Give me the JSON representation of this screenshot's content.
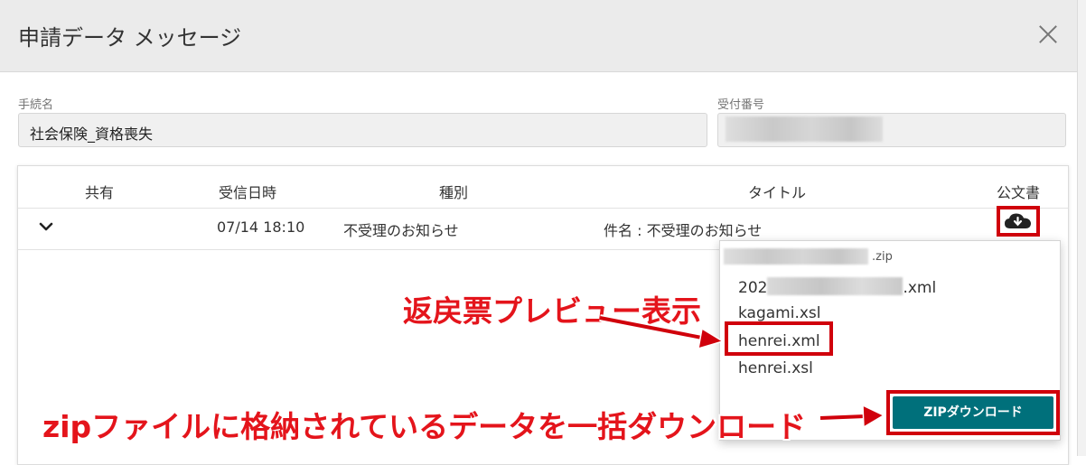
{
  "dialog": {
    "title": "申請データ メッセージ"
  },
  "fields": {
    "procedure_label": "手続名",
    "procedure_value": "社会保険_資格喪失",
    "receipt_label": "受付番号"
  },
  "table": {
    "headers": {
      "share": "共有",
      "received": "受信日時",
      "type": "種別",
      "title": "タイトル",
      "official": "公文書"
    },
    "row": {
      "received": "07/14 18:10",
      "type": "不受理のお知らせ",
      "title": "件名 : 不受理のお知らせ"
    }
  },
  "dropdown": {
    "zip_suffix": ".zip",
    "files": [
      {
        "prefix": "202",
        "suffix": ".xml"
      },
      {
        "name": "kagami.xsl"
      },
      {
        "name": "henrei.xml"
      },
      {
        "name": "henrei.xsl"
      }
    ],
    "zip_button": "ZIPダウンロード"
  },
  "annotations": {
    "preview": "返戻票プレビュー表示",
    "bulk": "zipファイルに格納されているデータを一括ダウンロード"
  },
  "colors": {
    "highlight": "#d0000b",
    "annotation": "#e4141b",
    "button": "#00707b"
  }
}
